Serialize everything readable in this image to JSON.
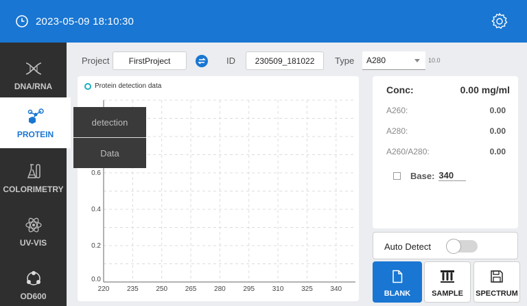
{
  "header": {
    "datetime": "2023-05-09 18:10:30",
    "icons": [
      "clock-icon",
      "gear-icon"
    ]
  },
  "sidebar": {
    "items": [
      {
        "label": "DNA/RNA",
        "icon": "dna-icon"
      },
      {
        "label": "PROTEIN",
        "icon": "molecule-icon",
        "active": true
      },
      {
        "label": "COLORIMETRY",
        "icon": "flask-icon"
      },
      {
        "label": "UV-VIS",
        "icon": "atom-icon"
      },
      {
        "label": "OD600",
        "icon": "cells-icon"
      }
    ]
  },
  "popup": {
    "items": [
      "detection",
      "Data"
    ]
  },
  "project": {
    "project_label": "Project",
    "project_value": "FirstProject",
    "id_label": "ID",
    "id_value": "230509_181022",
    "type_label": "Type",
    "type_value": "A280",
    "factor": "10.0"
  },
  "chart_data": {
    "type": "line",
    "series": [
      {
        "name": "Protein detection data",
        "values": []
      }
    ],
    "x_ticks": [
      "220",
      "235",
      "250",
      "265",
      "280",
      "295",
      "310",
      "325",
      "340"
    ],
    "y_ticks": [
      "0.0",
      "0.2",
      "0.4",
      "0.6"
    ],
    "xlim": [
      220,
      350
    ],
    "ylim": [
      0,
      1.0
    ],
    "grid": true,
    "legend_position": "top-left"
  },
  "results": {
    "conc_label": "Conc:",
    "conc_value": "0.00 mg/ml",
    "rows": [
      {
        "label": "A260:",
        "value": "0.00"
      },
      {
        "label": "A280:",
        "value": "0.00"
      },
      {
        "label": "A260/A280:",
        "value": "0.00"
      }
    ],
    "base_label": "Base:",
    "base_value": "340",
    "base_checked": false
  },
  "auto_detect": {
    "label": "Auto Detect",
    "enabled": false
  },
  "actions": {
    "blank": "BLANK",
    "sample": "SAMPLE",
    "spectrum": "SPECTRUM"
  },
  "colors": {
    "header": "#1976d2",
    "sidebar": "#2f2f2f",
    "accent": "#1976d2",
    "legend": "#1ab1c1"
  }
}
